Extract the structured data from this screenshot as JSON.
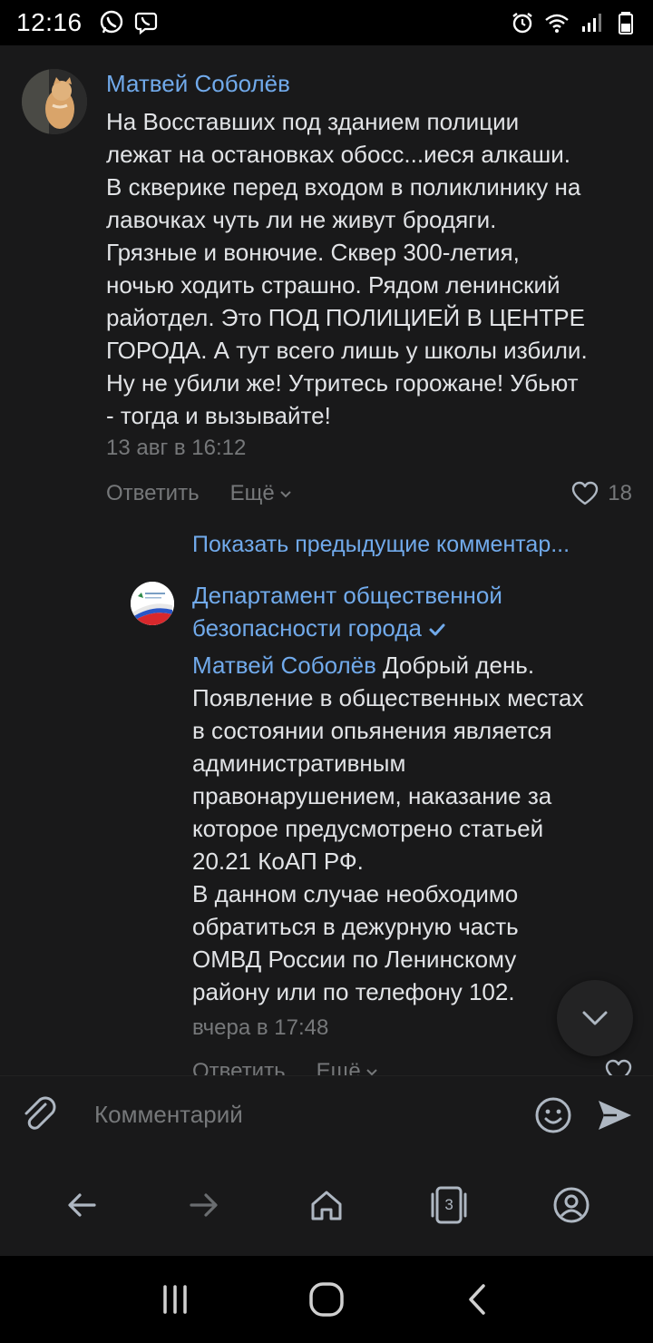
{
  "status_bar": {
    "time": "12:16",
    "left_icons": [
      "whatsapp-icon",
      "viber-icon"
    ],
    "right_icons": [
      "alarm-icon",
      "wifi-icon",
      "signal-icon",
      "battery-icon"
    ]
  },
  "comment": {
    "author": "Матвей Соболёв",
    "text": "На Восставших под зданием полиции\nлежат на остановках обосс...иеся алкаши.\nВ скверике перед входом в поликлинику на\nлавочках чуть ли не живут бродяги.\nГрязные и вонючие. Сквер 300-летия,\nночью ходить страшно. Рядом ленинский\nрайотдел. Это ПОД ПОЛИЦИЕЙ В ЦЕНТРЕ\nГОРОДА. А тут всего лишь у школы избили.\nНу не убили же! Утритесь горожане! Убьют\n- тогда и вызывайте!",
    "date": "13 авг в 16:12",
    "reply_label": "Ответить",
    "more_label": "Ещё",
    "likes": "18"
  },
  "show_previous": "Показать предыдущие комментар...",
  "reply": {
    "author": "Департамент общественной безопасности города",
    "mention": "Матвей Соболёв",
    "text": " Добрый день.\nПоявление в общественных местах\nв состоянии опьянения является\nадминистративным\nправонарушением, наказание за\nкоторое предусмотрено статьей\n20.21 КоАП РФ.\nВ данном случае необходимо\nобратиться в дежурную часть\nОМВД России по Ленинскому\nрайону или по телефону 102.",
    "date": "вчера в 17:48",
    "reply_label": "Ответить",
    "more_label": "Ещё"
  },
  "comment_bar": {
    "placeholder": "Комментарий"
  },
  "browser_nav": {
    "tabs_count": "3"
  },
  "colors": {
    "background": "#19191a",
    "accent": "#71aaeb",
    "secondary_text": "#76787a",
    "primary_text": "#e1e3e6"
  }
}
